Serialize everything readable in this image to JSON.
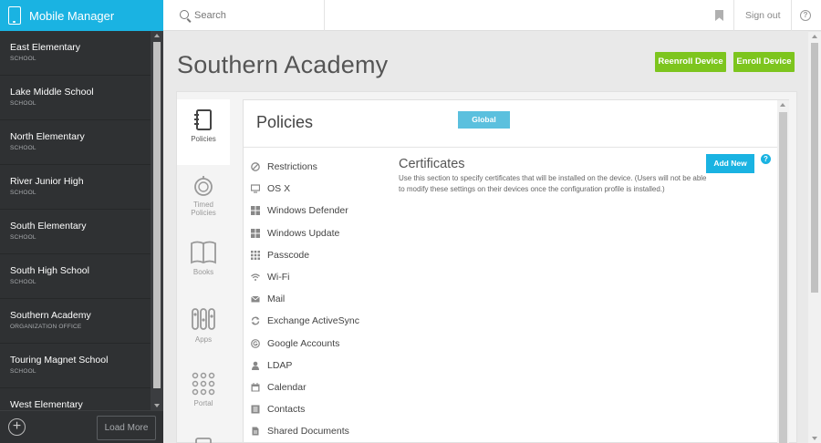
{
  "app": {
    "title": "Mobile Manager"
  },
  "sidebar": {
    "items": [
      {
        "name": "East Elementary",
        "type": "SCHOOL"
      },
      {
        "name": "Lake Middle School",
        "type": "SCHOOL"
      },
      {
        "name": "North Elementary",
        "type": "SCHOOL"
      },
      {
        "name": "River Junior High",
        "type": "SCHOOL"
      },
      {
        "name": "South Elementary",
        "type": "SCHOOL"
      },
      {
        "name": "South High School",
        "type": "SCHOOL"
      },
      {
        "name": "Southern Academy",
        "type": "ORGANIZATION OFFICE"
      },
      {
        "name": "Touring Magnet School",
        "type": "SCHOOL"
      },
      {
        "name": "West Elementary",
        "type": ""
      }
    ],
    "add_icon": "plus-circle-icon",
    "load_more": "Load More"
  },
  "topbar": {
    "search_placeholder": "Search",
    "signout": "Sign out",
    "help": "?"
  },
  "page": {
    "title": "Southern Academy",
    "reenroll": "Reenroll Device",
    "enroll": "Enroll Device"
  },
  "tabs": [
    {
      "label": "Policies",
      "icon": "notebook-icon"
    },
    {
      "label": "Timed Policies",
      "icon": "stopwatch-icon"
    },
    {
      "label": "Books",
      "icon": "book-icon"
    },
    {
      "label": "Apps",
      "icon": "apps-icon"
    },
    {
      "label": "Portal",
      "icon": "grid-icon"
    }
  ],
  "policies": {
    "title": "Policies",
    "global": "Global",
    "menu": [
      {
        "label": "Restrictions",
        "icon": "restrictions-icon"
      },
      {
        "label": "OS X",
        "icon": "monitor-icon"
      },
      {
        "label": "Windows Defender",
        "icon": "windows-icon"
      },
      {
        "label": "Windows Update",
        "icon": "windows-icon"
      },
      {
        "label": "Passcode",
        "icon": "keypad-icon"
      },
      {
        "label": "Wi-Fi",
        "icon": "wifi-icon"
      },
      {
        "label": "Mail",
        "icon": "mail-icon"
      },
      {
        "label": "Exchange ActiveSync",
        "icon": "sync-icon"
      },
      {
        "label": "Google Accounts",
        "icon": "google-icon"
      },
      {
        "label": "LDAP",
        "icon": "user-icon"
      },
      {
        "label": "Calendar",
        "icon": "calendar-icon"
      },
      {
        "label": "Contacts",
        "icon": "contacts-icon"
      },
      {
        "label": "Shared Documents",
        "icon": "document-icon"
      }
    ],
    "certificates": {
      "title": "Certificates",
      "description": "Use this section to specify certificates that will be installed on the device. (Users will not be able to modify these settings on their devices once the configuration profile is installed.)",
      "add_new": "Add New",
      "help": "?"
    }
  },
  "colors": {
    "accent": "#1ab3e2",
    "green": "#7dc51e",
    "sidebar": "#2f3133"
  }
}
